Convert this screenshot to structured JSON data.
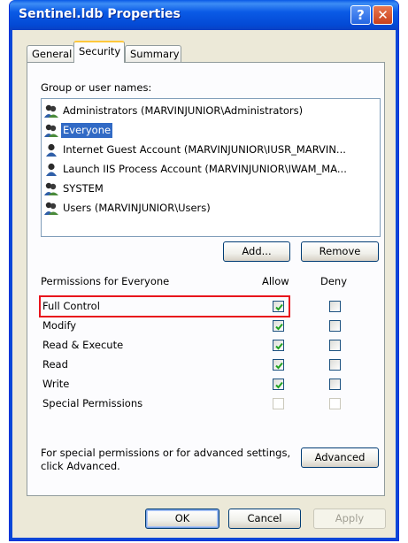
{
  "window": {
    "title": "Sentinel.ldb Properties"
  },
  "titlebar": {
    "help_glyph": "?",
    "close_glyph": "✕"
  },
  "tabs": [
    {
      "label": "General"
    },
    {
      "label": "Security"
    },
    {
      "label": "Summary"
    }
  ],
  "security": {
    "group_label": "Group or user names:",
    "users": [
      {
        "name": "Administrators (MARVINJUNIOR\\Administrators)",
        "icon": "group-icon",
        "selected": false
      },
      {
        "name": "Everyone",
        "icon": "group-icon",
        "selected": true
      },
      {
        "name": "Internet Guest Account (MARVINJUNIOR\\IUSR_MARVIN...",
        "icon": "user-icon",
        "selected": false
      },
      {
        "name": "Launch IIS Process Account (MARVINJUNIOR\\IWAM_MA...",
        "icon": "user-icon",
        "selected": false
      },
      {
        "name": "SYSTEM",
        "icon": "group-icon",
        "selected": false
      },
      {
        "name": "Users (MARVINJUNIOR\\Users)",
        "icon": "group-icon",
        "selected": false
      }
    ],
    "add_label": "Add...",
    "remove_label": "Remove",
    "permissions_label": "Permissions for Everyone",
    "allow_header": "Allow",
    "deny_header": "Deny",
    "permissions": [
      {
        "name": "Full Control",
        "allow": true,
        "deny": false,
        "disabled": false
      },
      {
        "name": "Modify",
        "allow": true,
        "deny": false,
        "disabled": false
      },
      {
        "name": "Read & Execute",
        "allow": true,
        "deny": false,
        "disabled": false
      },
      {
        "name": "Read",
        "allow": true,
        "deny": false,
        "disabled": false
      },
      {
        "name": "Write",
        "allow": true,
        "deny": false,
        "disabled": false
      },
      {
        "name": "Special Permissions",
        "allow": false,
        "deny": false,
        "disabled": true
      }
    ],
    "advanced_text_line1": "For special permissions or for advanced settings,",
    "advanced_text_line2": "click Advanced.",
    "advanced_label": "Advanced"
  },
  "footer": {
    "ok_label": "OK",
    "cancel_label": "Cancel",
    "apply_label": "Apply"
  },
  "colors": {
    "titlebar": "#0a5ae6",
    "selection": "#316ac5",
    "highlight_box": "#e8131c",
    "dialog_face": "#ece9d8"
  }
}
